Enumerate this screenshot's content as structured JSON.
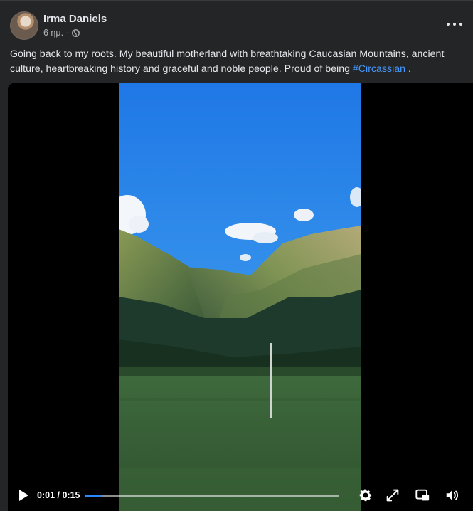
{
  "post": {
    "author": "Irma Daniels",
    "time": "6 ημ.",
    "separator": "·",
    "privacy_icon": "globe-icon",
    "more_icon": "more-horizontal-icon",
    "text": "Going back to my roots. My beautiful motherland with breathtaking Caucasian Mountains, ancient culture, heartbreaking history and graceful and noble people. Proud of being ",
    "hashtag": "#Circassian",
    "text_end": " ."
  },
  "video": {
    "current_time": "0:01",
    "time_separator": " / ",
    "duration": "0:15",
    "progress": 0.07,
    "play_icon": "play-icon",
    "settings_icon": "gear-icon",
    "fullscreen_icon": "expand-icon",
    "pip_icon": "picture-in-picture-icon",
    "volume_icon": "volume-icon"
  },
  "colors": {
    "background": "#242526",
    "text": "#e4e6eb",
    "secondary_text": "#b0b3b8",
    "link": "#4599ff",
    "progress": "#2d88ff"
  }
}
